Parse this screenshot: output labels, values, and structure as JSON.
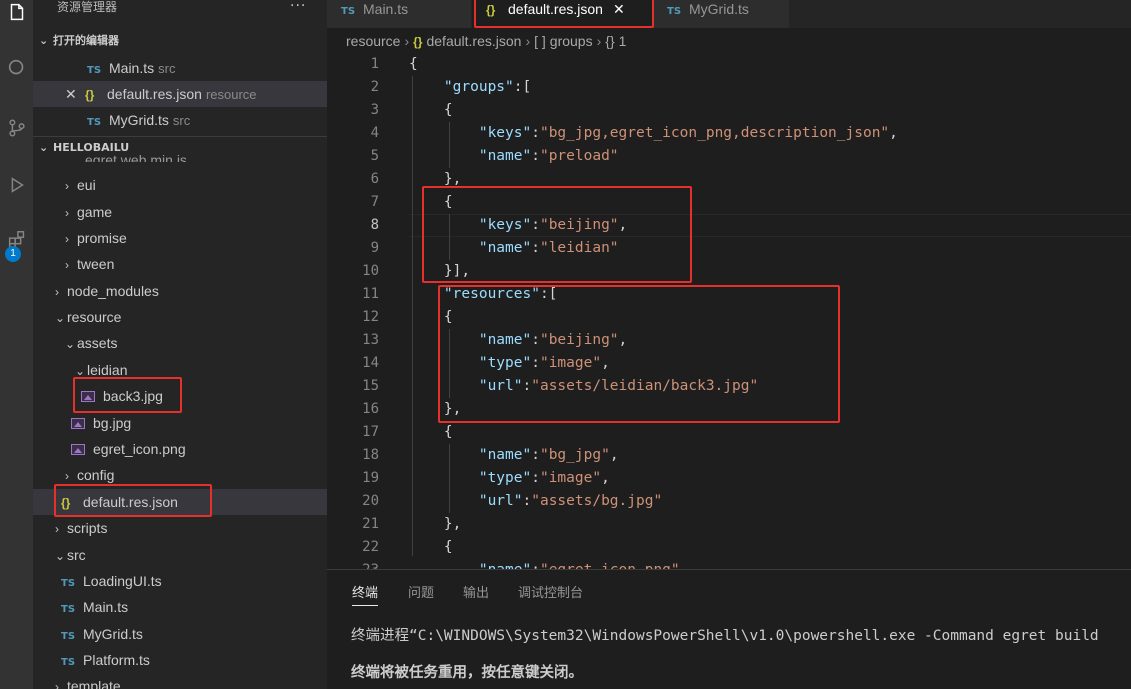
{
  "sidebar": {
    "title": "资源管理器",
    "more": "···",
    "open_editors": {
      "header": "打开的编辑器",
      "items": [
        {
          "icon": "TS",
          "name": "Main.ts",
          "hint": "src"
        },
        {
          "icon": "{}",
          "name": "default.res.json",
          "hint": "resource"
        },
        {
          "icon": "TS",
          "name": "MyGrid.ts",
          "hint": "src"
        }
      ]
    },
    "project": {
      "header": "HELLOBAILU",
      "partial": "egret.web.min.js",
      "items": [
        {
          "name": "eui"
        },
        {
          "name": "game"
        },
        {
          "name": "promise"
        },
        {
          "name": "tween"
        },
        {
          "name": "node_modules"
        },
        {
          "name": "resource"
        },
        {
          "name": "assets"
        },
        {
          "name": "leidian"
        },
        {
          "name": "back3.jpg"
        },
        {
          "name": "bg.jpg"
        },
        {
          "name": "egret_icon.png"
        },
        {
          "name": "config"
        },
        {
          "icon": "{}",
          "name": "default.res.json"
        },
        {
          "name": "scripts"
        },
        {
          "name": "src"
        },
        {
          "icon": "TS",
          "name": "LoadingUI.ts"
        },
        {
          "icon": "TS",
          "name": "Main.ts"
        },
        {
          "icon": "TS",
          "name": "MyGrid.ts"
        },
        {
          "icon": "TS",
          "name": "Platform.ts"
        },
        {
          "name": "template"
        }
      ]
    }
  },
  "tabs": [
    {
      "icon": "TS",
      "label": "Main.ts"
    },
    {
      "icon": "{}",
      "label": "default.res.json",
      "close": "✕"
    },
    {
      "icon": "TS",
      "label": "MyGrid.ts"
    }
  ],
  "breadcrumb": {
    "folder": "resource",
    "file_icon": "{}",
    "file": "default.res.json",
    "array_icon": "[ ]",
    "array": "groups",
    "obj_icon": "{}",
    "obj": "1"
  },
  "editor": {
    "line_numbers": [
      "1",
      "2",
      "3",
      "4",
      "5",
      "6",
      "7",
      "8",
      "9",
      "10",
      "11",
      "12",
      "13",
      "14",
      "15",
      "16",
      "17",
      "18",
      "19",
      "20",
      "21",
      "22",
      "23"
    ],
    "lines": [
      {
        "p": "{"
      },
      {
        "ind": "    ",
        "k": "\"groups\"",
        "p": ":["
      },
      {
        "ind": "    ",
        "p": "{"
      },
      {
        "ind": "        ",
        "k": "\"keys\"",
        "p": ":",
        "s": "\"bg_jpg,egret_icon_png,description_json\"",
        "p2": ","
      },
      {
        "ind": "        ",
        "k": "\"name\"",
        "p": ":",
        "s": "\"preload\""
      },
      {
        "ind": "    ",
        "p": "},"
      },
      {
        "ind": "    ",
        "p": "{"
      },
      {
        "ind": "        ",
        "k": "\"keys\"",
        "p": ":",
        "s": "\"beijing\"",
        "p2": ","
      },
      {
        "ind": "        ",
        "k": "\"name\"",
        "p": ":",
        "s": "\"leidian\""
      },
      {
        "ind": "    ",
        "p": "}],"
      },
      {
        "ind": "    ",
        "k": "\"resources\"",
        "p": ":["
      },
      {
        "ind": "    ",
        "p": "{"
      },
      {
        "ind": "        ",
        "k": "\"name\"",
        "p": ":",
        "s": "\"beijing\"",
        "p2": ","
      },
      {
        "ind": "        ",
        "k": "\"type\"",
        "p": ":",
        "s": "\"image\"",
        "p2": ","
      },
      {
        "ind": "        ",
        "k": "\"url\"",
        "p": ":",
        "s": "\"assets/leidian/back3.jpg\""
      },
      {
        "ind": "    ",
        "p": "},"
      },
      {
        "ind": "    ",
        "p": "{"
      },
      {
        "ind": "        ",
        "k": "\"name\"",
        "p": ":",
        "s": "\"bg_jpg\"",
        "p2": ","
      },
      {
        "ind": "        ",
        "k": "\"type\"",
        "p": ":",
        "s": "\"image\"",
        "p2": ","
      },
      {
        "ind": "        ",
        "k": "\"url\"",
        "p": ":",
        "s": "\"assets/bg.jpg\""
      },
      {
        "ind": "    ",
        "p": "},"
      },
      {
        "ind": "    ",
        "p": "{"
      },
      {
        "ind": "        ",
        "k": "\"name\"",
        "p": ":",
        "s": "\"egret_icon_png\"",
        "p2": ","
      }
    ]
  },
  "panel": {
    "tabs": [
      "终端",
      "问题",
      "输出",
      "调试控制台"
    ],
    "terminal": [
      "终端进程“C:\\WINDOWS\\System32\\WindowsPowerShell\\v1.0\\powershell.exe -Command egret build",
      "终端将被任务重用，按任意键关闭。"
    ]
  },
  "activity": {
    "badge": "1"
  },
  "colors": {
    "accent": "#007acc",
    "highlight": "#e5302c",
    "json_key": "#9cdcfe",
    "json_string": "#ce9178"
  }
}
